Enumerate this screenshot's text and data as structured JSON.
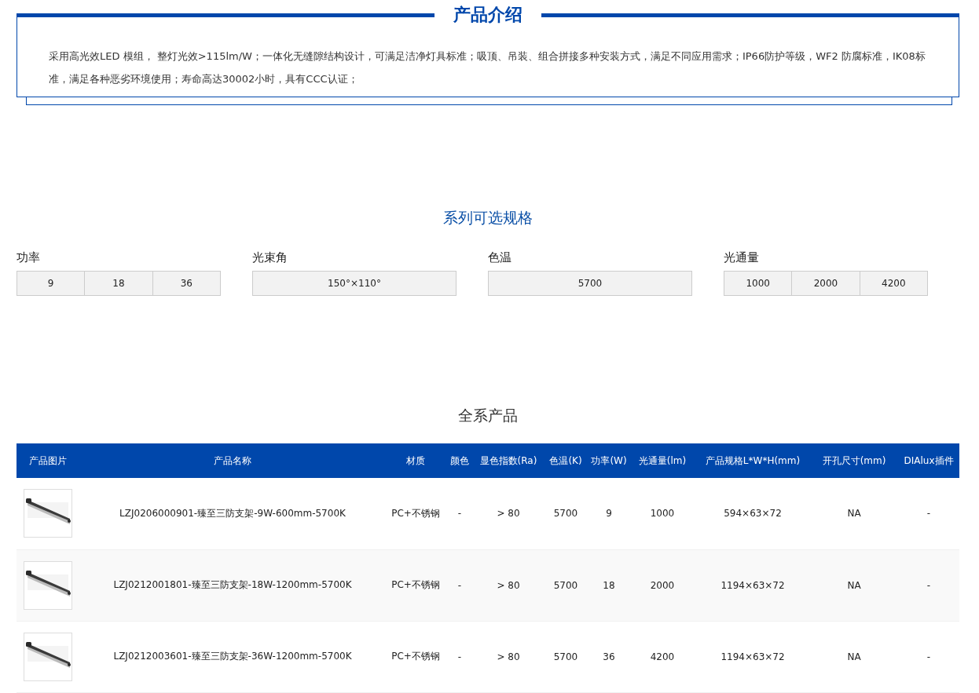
{
  "intro": {
    "title": "产品介绍",
    "text": "采用高光效LED 模组， 整灯光效>115lm/W；一体化无缝隙结构设计，可满足洁净灯具标准；吸顶、吊装、组合拼接多种安装方式，满足不同应用需求；IP66防护等级，WF2 防腐标准，IK08标准，满足各种恶劣环境使用；寿命高达30002小时，具有CCC认证；"
  },
  "specs": {
    "title": "系列可选规格",
    "groups": [
      {
        "label": "功率",
        "options": [
          "9",
          "18",
          "36"
        ]
      },
      {
        "label": "光束角",
        "options": [
          "150°×110°"
        ]
      },
      {
        "label": "色温",
        "options": [
          "5700"
        ]
      },
      {
        "label": "光通量",
        "options": [
          "1000",
          "2000",
          "4200"
        ]
      }
    ]
  },
  "products": {
    "title": "全系产品",
    "columns": [
      "产品图片",
      "产品名称",
      "材质",
      "颜色",
      "显色指数(Ra)",
      "色温(K)",
      "功率(W)",
      "光通量(lm)",
      "产品规格L*W*H(mm)",
      "开孔尺寸(mm)",
      "DIAlux插件"
    ],
    "rows": [
      {
        "cells": [
          {
            "kind": "picture"
          },
          "LZJ0206000901-臻至三防支架-9W-600mm-5700K",
          "PC+不锈钢",
          "-",
          "> 80",
          "5700",
          "9",
          "1000",
          "594×63×72",
          "NA",
          "-"
        ]
      },
      {
        "cells": [
          {
            "kind": "picture"
          },
          "LZJ0212001801-臻至三防支架-18W-1200mm-5700K",
          "PC+不锈钢",
          "-",
          "> 80",
          "5700",
          "18",
          "2000",
          "1194×63×72",
          "NA",
          "-"
        ]
      },
      {
        "cells": [
          {
            "kind": "picture"
          },
          "LZJ0212003601-臻至三防支架-36W-1200mm-5700K",
          "PC+不锈钢",
          "-",
          "> 80",
          "5700",
          "36",
          "4200",
          "1194×63×72",
          "NA",
          "-"
        ]
      }
    ]
  }
}
